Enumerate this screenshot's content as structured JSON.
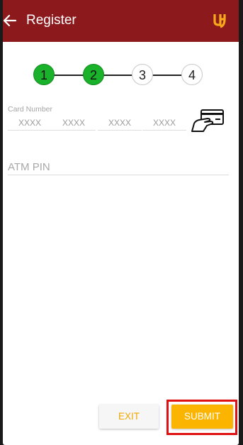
{
  "header": {
    "title": "Register",
    "back_icon": "arrow-left-icon",
    "logo_icon": "bank-logo-icon"
  },
  "stepper": {
    "steps": [
      {
        "label": "1",
        "state": "done"
      },
      {
        "label": "2",
        "state": "done"
      },
      {
        "label": "3",
        "state": "todo"
      },
      {
        "label": "4",
        "state": "todo"
      }
    ]
  },
  "form": {
    "card_number_label": "Card Number",
    "card_placeholders": [
      "XXXX",
      "XXXX",
      "XXXX",
      "XXXX"
    ],
    "card_icon": "credit-card-icon",
    "atm_pin_placeholder": "ATM PIN"
  },
  "footer": {
    "exit_label": "EXIT",
    "submit_label": "SUBMIT"
  },
  "colors": {
    "appbar": "#8c1a1c",
    "step_done": "#19b22a",
    "accent": "#fbb400",
    "highlight": "#e01010"
  }
}
